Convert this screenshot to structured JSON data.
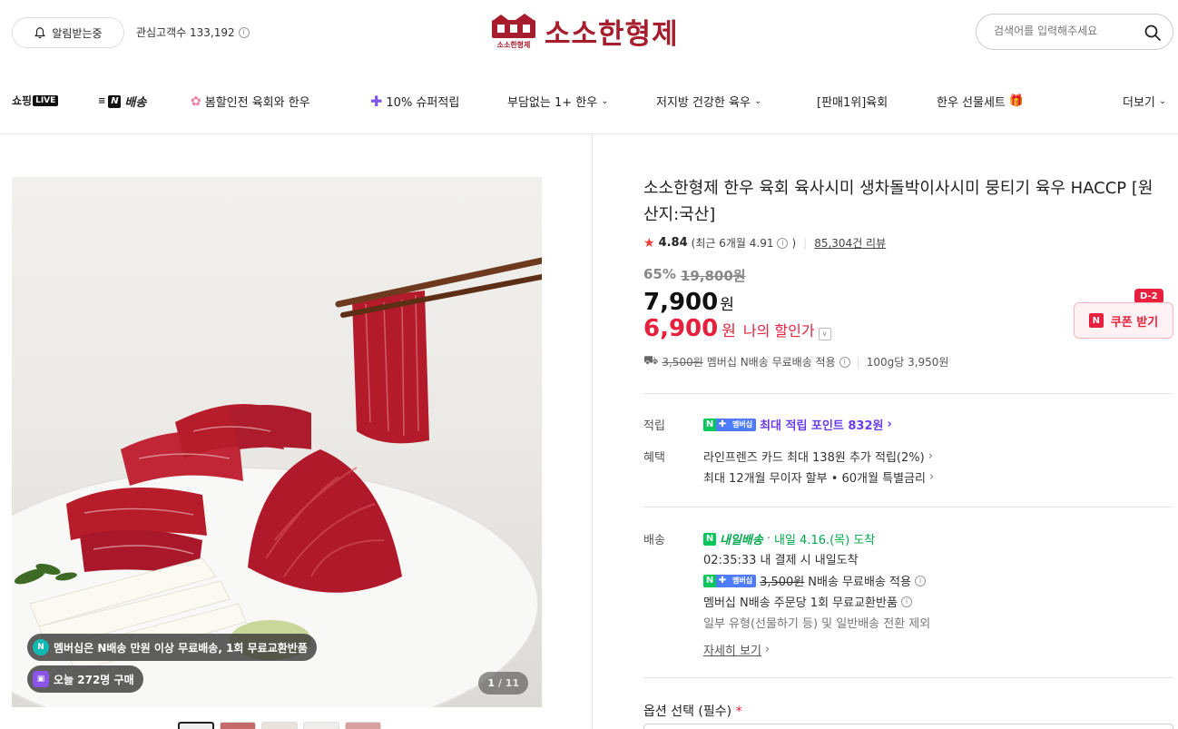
{
  "header": {
    "alarm_label": "알림받는중",
    "fans_label": "관심고객수 133,192",
    "logo_text": "소소한형제",
    "logo_mark_text": "소소한형제",
    "search_placeholder": "검색어를 입력해주세요"
  },
  "nav": {
    "live_text": "쇼핑",
    "live_badge": "LIVE",
    "n_delivery": "배송",
    "items": [
      "봄할인전 육회와 한우",
      "10% 슈퍼적립",
      "부담없는 1+ 한우",
      "저지방 건강한 육우",
      "[판매1위]육회",
      "한우 선물세트",
      "더보기"
    ]
  },
  "gallery": {
    "badge_membership": "멤버십은 N배송 만원 이상 무료배송, 1회 무료교환반품",
    "badge_today": "오늘 272명 구매",
    "counter_current": "1",
    "counter_total": "/ 11"
  },
  "product": {
    "title": "소소한형제 한우 육회 육사시미 생차돌박이사시미 뭉티기 육우 HACCP [원산지:국산]",
    "rating": "4.84",
    "rating_recent": "(최근 6개월 4.91",
    "rating_recent_close": ")",
    "review_count": "85,304건 리뷰",
    "discount_rate": "65%",
    "original_price": "19,800원",
    "price": "7,900",
    "price_unit": "원",
    "my_price": "6,900",
    "my_price_unit": "원",
    "my_price_label": "나의 할인가",
    "coupon_label": "쿠폰 받기",
    "coupon_dday": "D-2",
    "ship_fee_strike": "3,500원",
    "ship_text": "멤버십 N배송 무료배송 적용",
    "unit_price": "100g당 3,950원"
  },
  "benefits": {
    "points_label": "적립",
    "points_badge": "멤버십",
    "points_text": "최대 적립 포인트 832원",
    "benefit_label": "혜택",
    "benefit_1": "라인프렌즈 카드 최대 138원 추가 적립(2%)",
    "benefit_2": "최대 12개월 무이자 할부 • 60개월 특별금리"
  },
  "delivery": {
    "label": "배송",
    "tomorrow_badge": "내일배송",
    "arrival": "내일 4.16.(목) 도착",
    "deadline": "02:35:33  내 결제 시 내일도착",
    "member_badge": "멤버십",
    "fee_strike": "3,500원",
    "fee_text": "N배송 무료배송 적용",
    "exchange": "멤버십 N배송 주문당 1회 무료교환반품",
    "exception": "일부 유형(선물하기 등) 및 일반배송 전환 제외",
    "detail_link": "자세히 보기"
  },
  "option": {
    "label": "옵션 선택 (필수)",
    "required_mark": "*"
  },
  "colors": {
    "brand": "#a61e2d",
    "sale": "#e6203d",
    "naver_green": "#03c75a",
    "points_purple": "#6a3ee8"
  }
}
